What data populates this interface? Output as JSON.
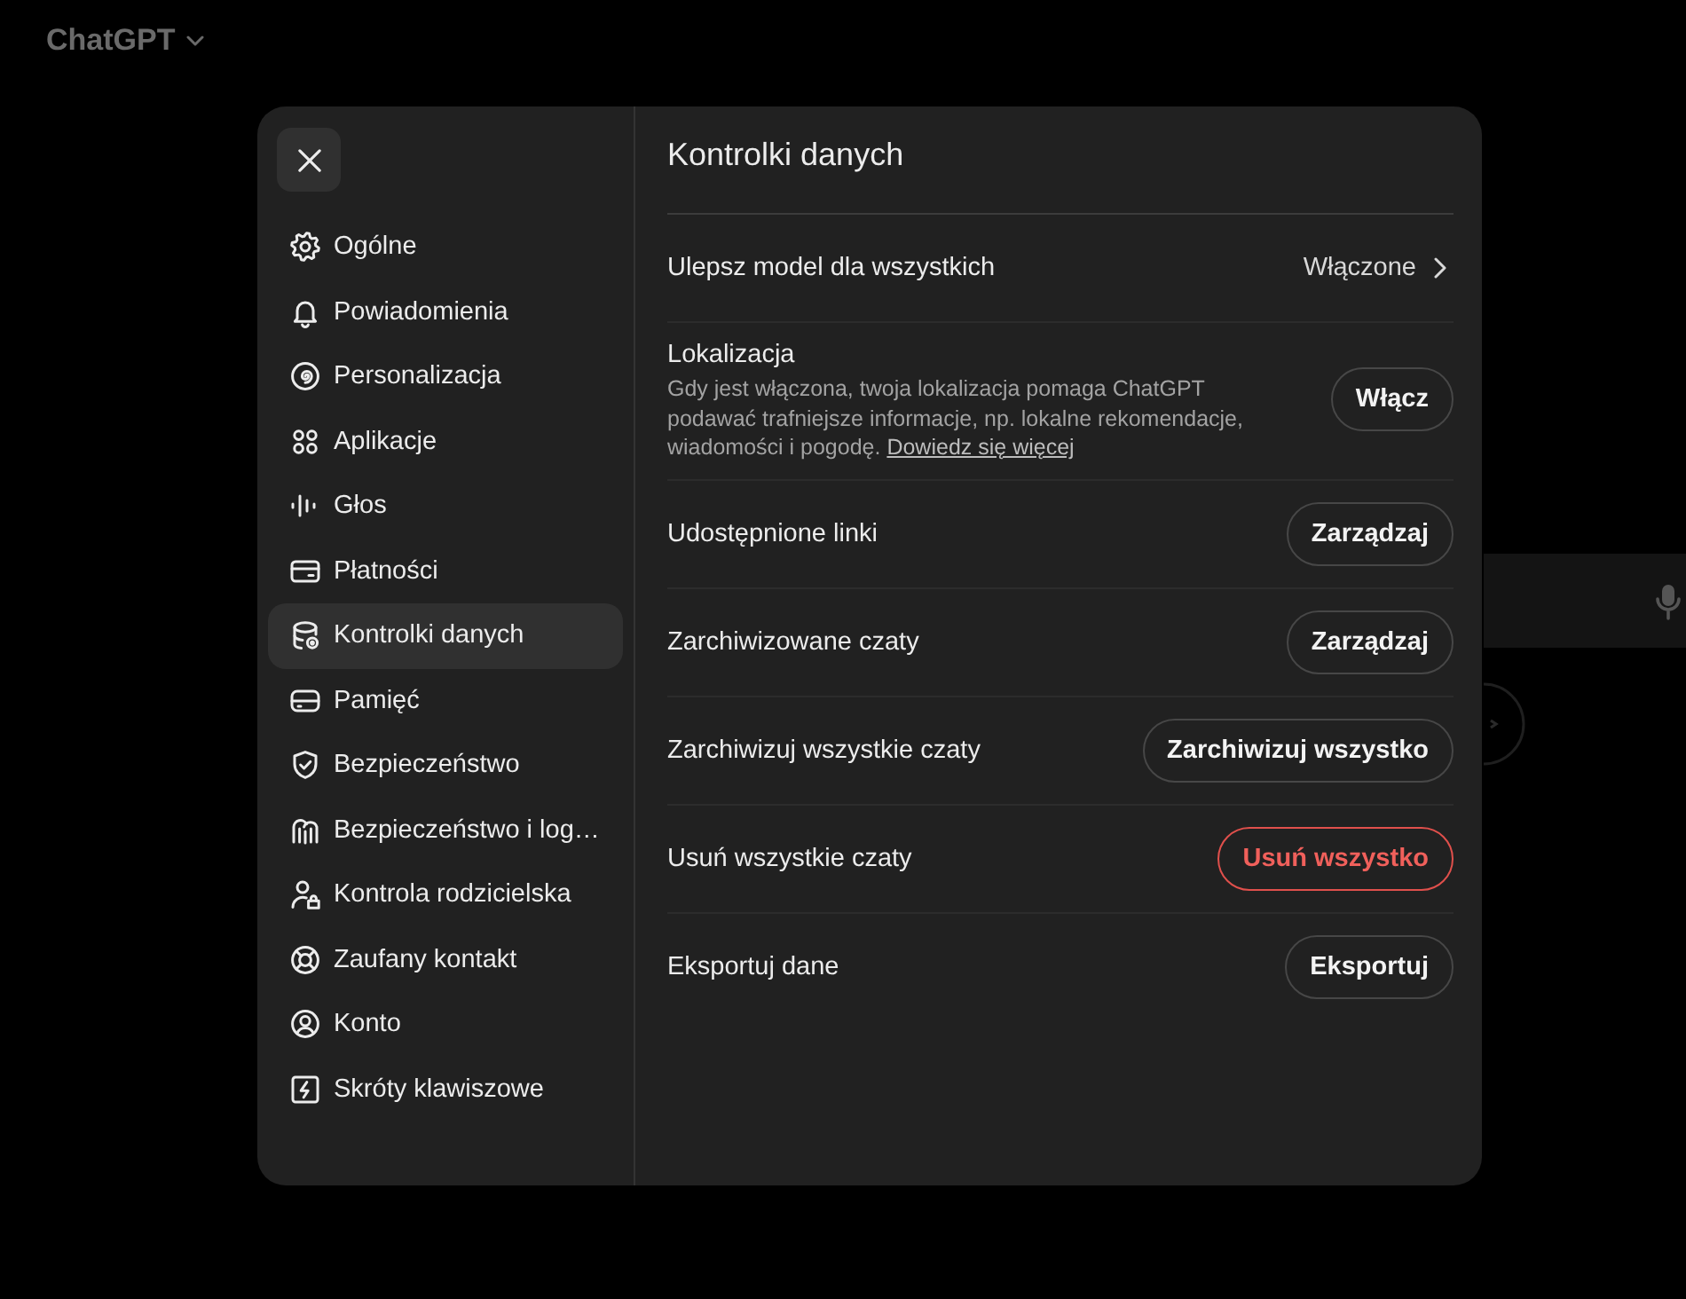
{
  "header": {
    "title": "ChatGPT"
  },
  "dialog": {
    "title": "Kontrolki danych",
    "nav": [
      {
        "label": "Ogólne",
        "selected": false
      },
      {
        "label": "Powiadomienia",
        "selected": false
      },
      {
        "label": "Personalizacja",
        "selected": false
      },
      {
        "label": "Aplikacje",
        "selected": false
      },
      {
        "label": "Głos",
        "selected": false
      },
      {
        "label": "Płatności",
        "selected": false
      },
      {
        "label": "Kontrolki danych",
        "selected": true
      },
      {
        "label": "Pamięć",
        "selected": false
      },
      {
        "label": "Bezpieczeństwo",
        "selected": false
      },
      {
        "label": "Bezpieczeństwo i log…",
        "selected": false
      },
      {
        "label": "Kontrola rodzicielska",
        "selected": false
      },
      {
        "label": "Zaufany kontakt",
        "selected": false
      },
      {
        "label": "Konto",
        "selected": false
      },
      {
        "label": "Skróty klawiszowe",
        "selected": false
      }
    ],
    "settings": [
      {
        "kind": "value",
        "label": "Ulepsz model dla wszystkich",
        "value": "Włączone"
      },
      {
        "kind": "button",
        "label": "Lokalizacja",
        "description": "Gdy jest włączona, twoja lokalizacja pomaga ChatGPT podawać trafniejsze informacje, np. lokalne rekomendacje, wiadomości i pogodę.",
        "link": "Dowiedz się więcej",
        "action": {
          "label": "Włącz",
          "destructive": false
        }
      },
      {
        "kind": "button",
        "label": "Udostępnione linki",
        "action": {
          "label": "Zarządzaj",
          "destructive": false
        }
      },
      {
        "kind": "button",
        "label": "Zarchiwizowane czaty",
        "action": {
          "label": "Zarządzaj",
          "destructive": false
        }
      },
      {
        "kind": "button",
        "label": "Zarchiwizuj wszystkie czaty",
        "action": {
          "label": "Zarchiwizuj wszystko",
          "destructive": false
        }
      },
      {
        "kind": "button",
        "label": "Usuń wszystkie czaty",
        "action": {
          "label": "Usuń wszystko",
          "destructive": true
        }
      },
      {
        "kind": "button",
        "label": "Eksportuj dane",
        "action": {
          "label": "Eksportuj",
          "destructive": false
        }
      }
    ]
  }
}
